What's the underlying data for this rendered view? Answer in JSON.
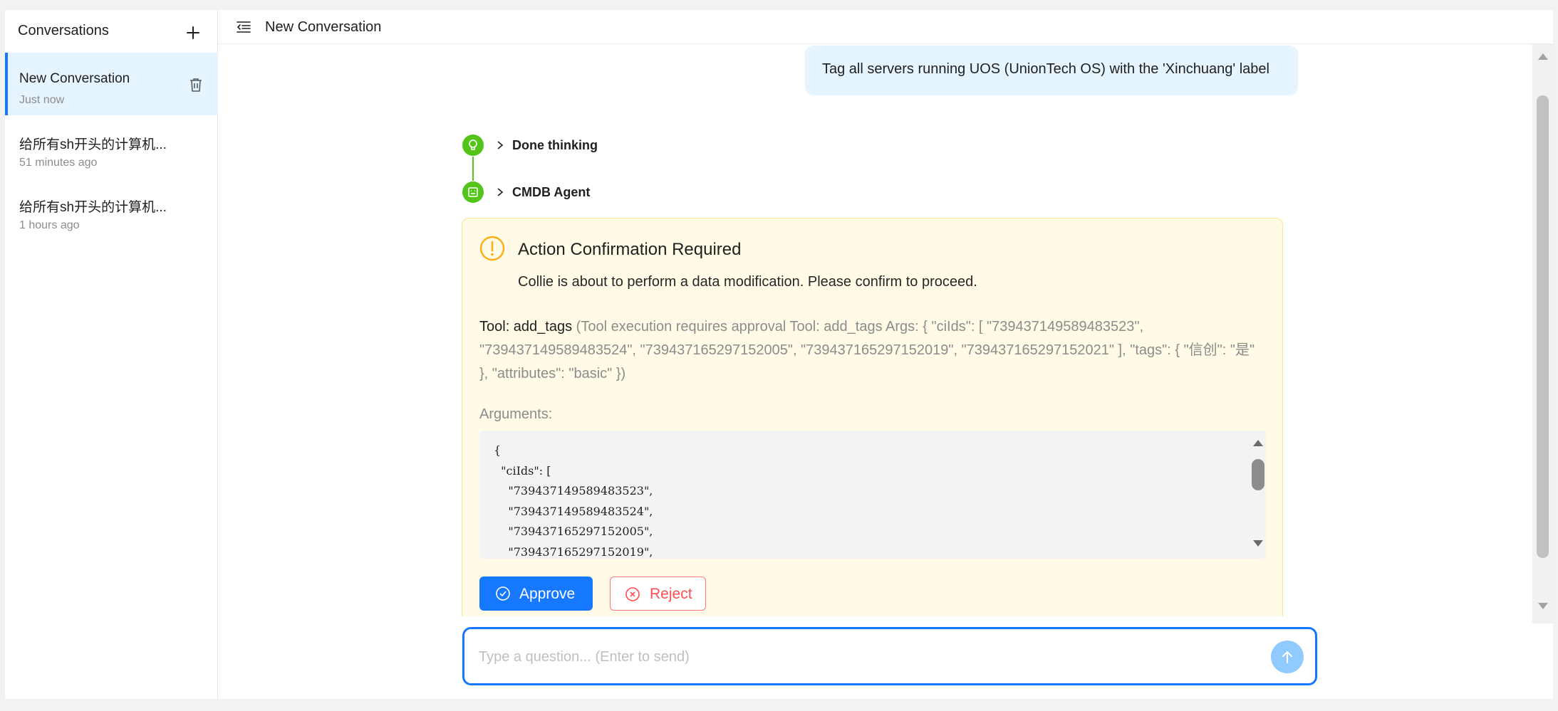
{
  "sidebar": {
    "title": "Conversations",
    "add_icon": "plus-icon",
    "conversations": [
      {
        "title": "New Conversation",
        "time": "Just now",
        "active": true
      },
      {
        "title": "给所有sh开头的计算机...",
        "time": "51 minutes ago",
        "active": false
      },
      {
        "title": "给所有sh开头的计算机...",
        "time": "1 hours ago",
        "active": false
      }
    ]
  },
  "header": {
    "menu_icon": "menu-fold-icon",
    "title": "New Conversation"
  },
  "chat": {
    "user_message": "Tag all servers running UOS (UnionTech OS) with the 'Xinchuang' label",
    "steps": [
      {
        "label": "Done thinking",
        "icon": "lightbulb-icon",
        "status_color": "#52c41a"
      },
      {
        "label": "CMDB Agent",
        "icon": "robot-icon",
        "status_color": "#52c41a"
      }
    ],
    "confirmation": {
      "title": "Action Confirmation Required",
      "description": "Collie is about to perform a data modification. Please confirm to proceed.",
      "tool_label": "Tool: add_tags",
      "tool_detail": "(Tool execution requires approval Tool: add_tags Args: { \"ciIds\": [ \"739437149589483523\", \"739437149589483524\", \"739437165297152005\", \"739437165297152019\", \"739437165297152021\" ], \"tags\": { \"信创\": \"是\" }, \"attributes\": \"basic\" })",
      "arguments_label": "Arguments:",
      "arguments_code": "{\n  \"ciIds\": [\n    \"739437149589483523\",\n    \"739437149589483524\",\n    \"739437165297152005\",\n    \"739437165297152019\",",
      "approve_label": "Approve",
      "reject_label": "Reject"
    }
  },
  "composer": {
    "placeholder": "Type a question... (Enter to send)",
    "value": "",
    "send_icon": "arrow-up-icon"
  },
  "colors": {
    "accent": "#1677ff",
    "success": "#52c41a",
    "warning": "#faad14",
    "danger": "#ff4d4f",
    "warning_bg": "#fffbe6",
    "active_bg": "#e6f4ff"
  }
}
